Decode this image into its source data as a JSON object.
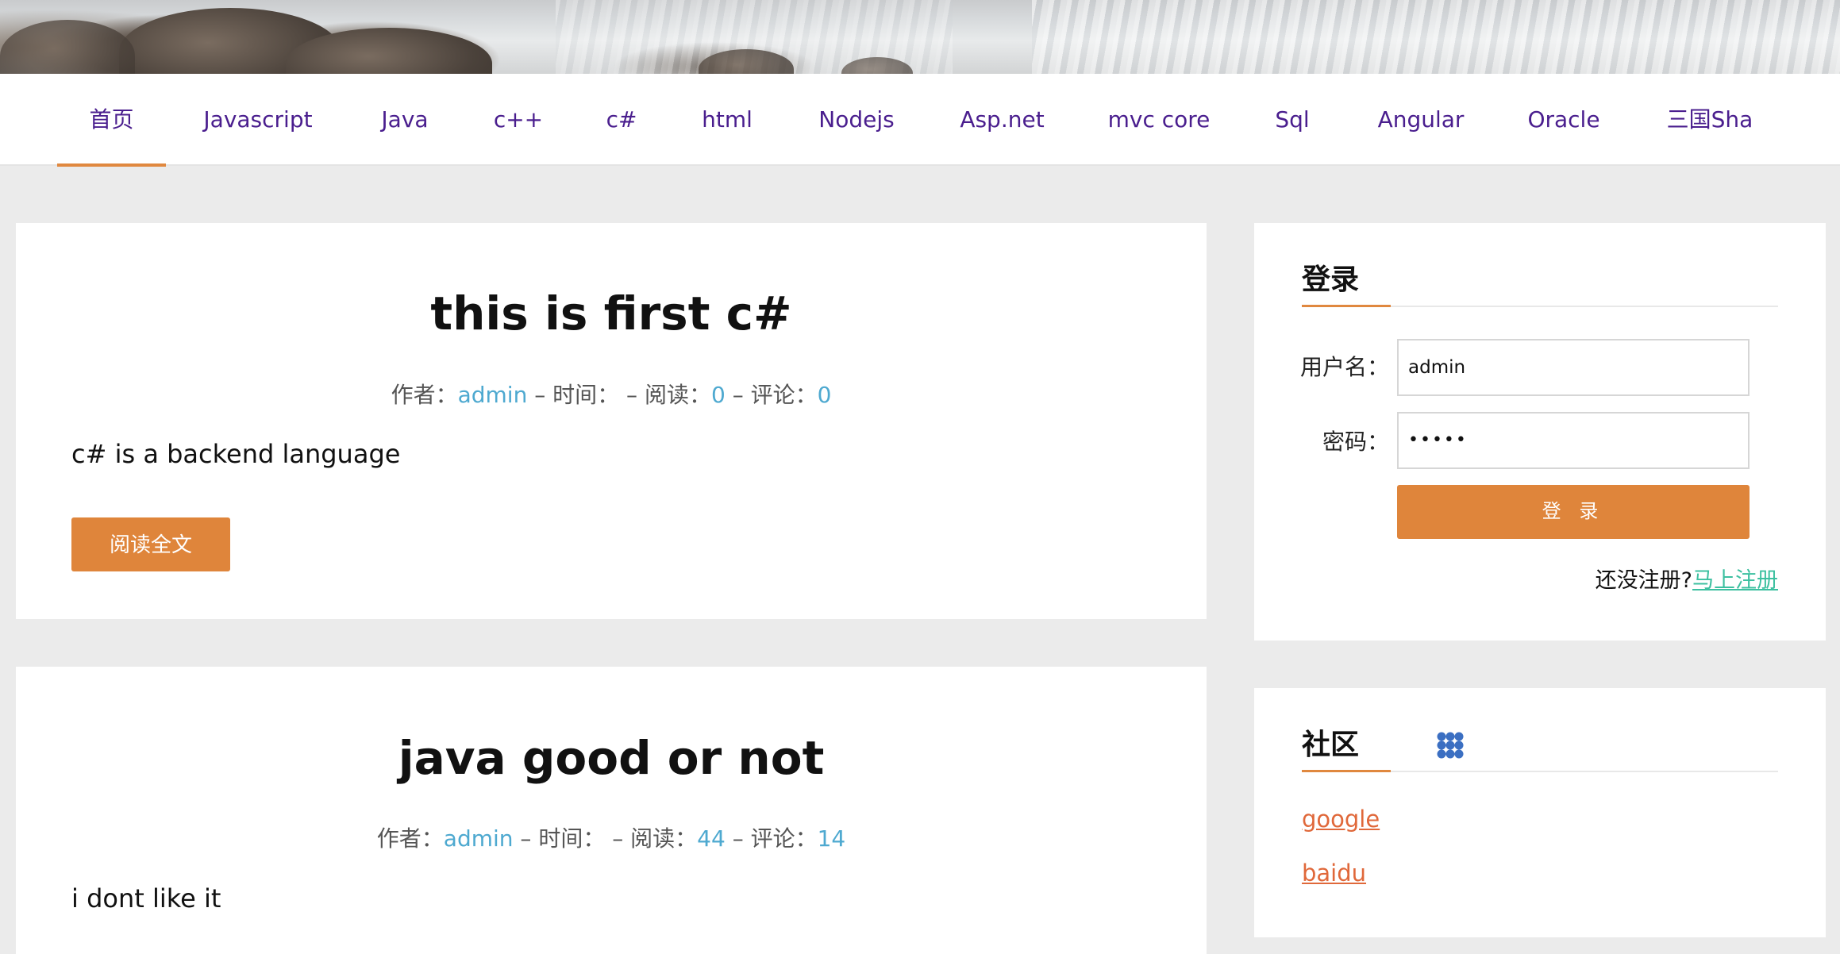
{
  "nav": {
    "items": [
      {
        "label": "首页",
        "active": true
      },
      {
        "label": "Javascript"
      },
      {
        "label": "Java"
      },
      {
        "label": "c++"
      },
      {
        "label": "c#"
      },
      {
        "label": "html"
      },
      {
        "label": "Nodejs"
      },
      {
        "label": "Asp.net"
      },
      {
        "label": "mvc core"
      },
      {
        "label": "Sql"
      },
      {
        "label": "Angular"
      },
      {
        "label": "Oracle"
      },
      {
        "label": "三国Sha"
      }
    ]
  },
  "articles": [
    {
      "title": "this is first c#",
      "author_label": "作者：",
      "author": "admin",
      "time_label": "– 时间：",
      "time": "",
      "reads_label": "– 阅读：",
      "reads": "0",
      "comments_label": "– 评论：",
      "comments": "0",
      "summary": "c# is a backend language",
      "read_more": "阅读全文"
    },
    {
      "title": "java good or not",
      "author_label": "作者：",
      "author": "admin",
      "time_label": "– 时间：",
      "time": "",
      "reads_label": "– 阅读：",
      "reads": "44",
      "comments_label": "– 评论：",
      "comments": "14",
      "summary": "i dont like it"
    }
  ],
  "login": {
    "title": "登录",
    "username_label": "用户名：",
    "username_value": "admin",
    "password_label": "密码：",
    "password_value": "•••••",
    "submit_label": "登 录",
    "register_prompt": "还没注册?",
    "register_link": "马上注册"
  },
  "community": {
    "title": "社区",
    "icon": "community-icon",
    "links": [
      "google",
      "baidu"
    ]
  },
  "colors": {
    "accent": "#df853b",
    "nav_text": "#4a1e8e",
    "meta_value": "#4ea9d0",
    "link": "#e0683a",
    "register_link": "#3cc0a0"
  }
}
